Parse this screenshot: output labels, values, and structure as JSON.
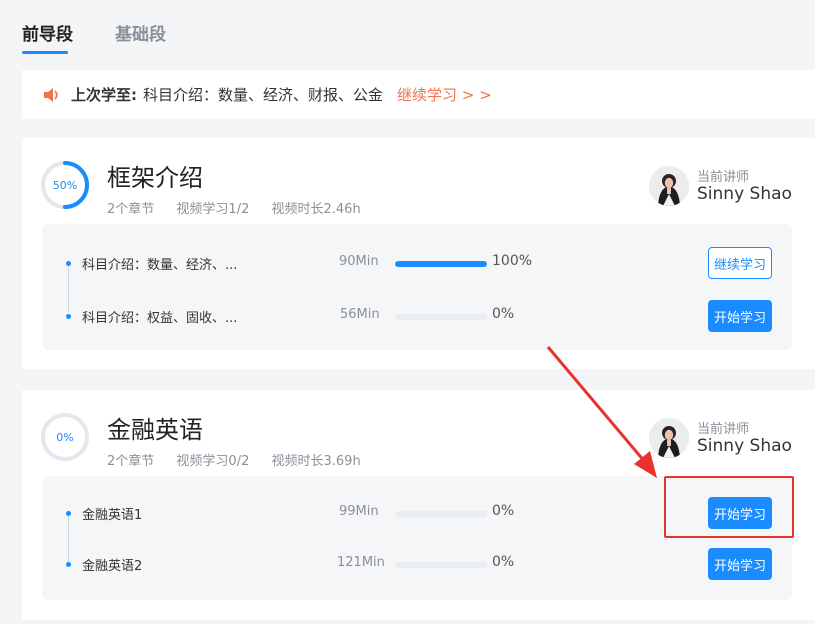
{
  "tabs": [
    {
      "label": "前导段",
      "active": true
    },
    {
      "label": "基础段",
      "active": false
    }
  ],
  "last_study": {
    "label": "上次学至:",
    "text": "科目介绍：数量、经济、财报、公金",
    "continue_link": "继续学习 > >"
  },
  "courses": [
    {
      "progress_pct": 50,
      "progress_text": "50%",
      "title": "框架介绍",
      "chapters_count": "2个章节",
      "video_progress": "视频学习1/2",
      "video_duration": "视频时长2.46h",
      "teacher_label": "当前讲师",
      "teacher_name": "Sinny Shao",
      "chapters": [
        {
          "title": "科目介绍：数量、经济、...",
          "duration": "90Min",
          "progress": 100,
          "progress_text": "100%",
          "button": "继续学习",
          "button_style": "outline"
        },
        {
          "title": "科目介绍：权益、固收、...",
          "duration": "56Min",
          "progress": 0,
          "progress_text": "0%",
          "button": "开始学习",
          "button_style": "primary"
        }
      ]
    },
    {
      "progress_pct": 0,
      "progress_text": "0%",
      "title": "金融英语",
      "chapters_count": "2个章节",
      "video_progress": "视频学习0/2",
      "video_duration": "视频时长3.69h",
      "teacher_label": "当前讲师",
      "teacher_name": "Sinny Shao",
      "chapters": [
        {
          "title": "金融英语1",
          "duration": "99Min",
          "progress": 0,
          "progress_text": "0%",
          "button": "开始学习",
          "button_style": "primary"
        },
        {
          "title": "金融英语2",
          "duration": "121Min",
          "progress": 0,
          "progress_text": "0%",
          "button": "开始学习",
          "button_style": "primary"
        }
      ]
    }
  ],
  "colors": {
    "accent": "#1a8cff",
    "link_orange": "#f2744f",
    "highlight_red": "#e8322b"
  }
}
